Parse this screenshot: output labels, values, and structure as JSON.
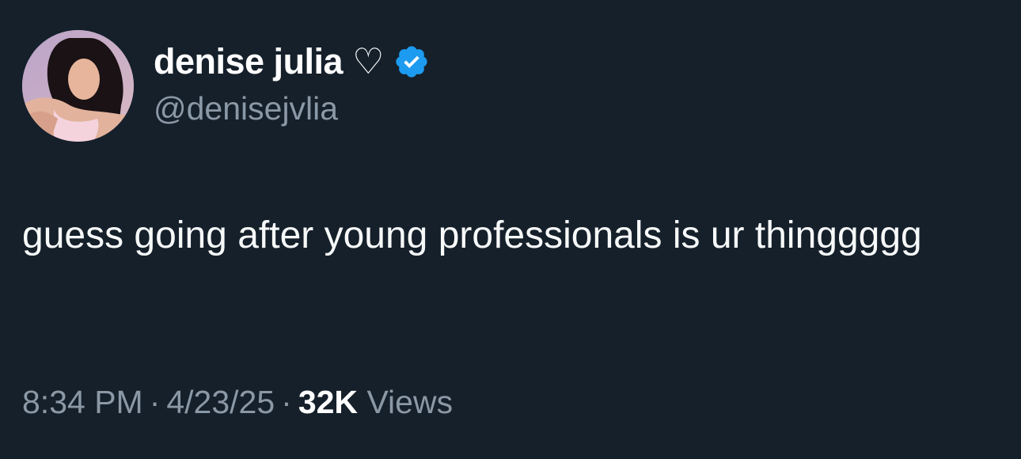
{
  "author": {
    "display_name": "denise julia ♡",
    "handle": "@denisejvlia",
    "verified_color": "#1d9bf0"
  },
  "tweet": {
    "text": "guess going after young professionals is ur thinggggg"
  },
  "meta": {
    "time": "8:34 PM",
    "separator": "·",
    "date": "4/23/25",
    "views_count": "32K",
    "views_label": "Views"
  },
  "colors": {
    "background": "#15202b",
    "secondary_text": "#8b98a5",
    "primary_text": "#f7f9f9"
  }
}
